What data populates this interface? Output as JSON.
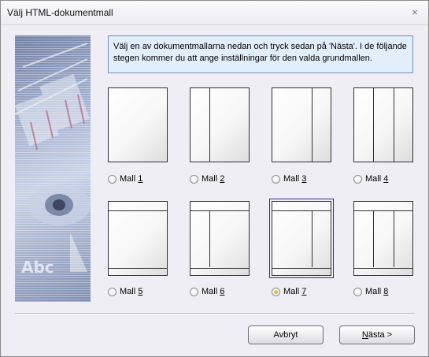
{
  "window": {
    "title": "Välj HTML-dokumentmall",
    "close_glyph": "×"
  },
  "side_art": {
    "text": "Abc"
  },
  "info": {
    "text": "Välj en av dokumentmallarna nedan och tryck sedan på 'Nästa'. I de följande stegen kommer du att ange inställningar för den valda grundmallen."
  },
  "templates": [
    {
      "label": "Mall ",
      "num": "1",
      "selected": false
    },
    {
      "label": "Mall ",
      "num": "2",
      "selected": false
    },
    {
      "label": "Mall ",
      "num": "3",
      "selected": false
    },
    {
      "label": "Mall ",
      "num": "4",
      "selected": false
    },
    {
      "label": "Mall ",
      "num": "5",
      "selected": false
    },
    {
      "label": "Mall ",
      "num": "6",
      "selected": false
    },
    {
      "label": "Mall ",
      "num": "7",
      "selected": true
    },
    {
      "label": "Mall ",
      "num": "8",
      "selected": false
    }
  ],
  "buttons": {
    "cancel": "Avbryt",
    "next_hotkey": "N",
    "next_rest": "ästa >"
  },
  "colors": {
    "info_bg": "#e3eefb",
    "info_border": "#6f8fbf",
    "selected_outline": "#2d2e8c",
    "radio_selected": "#d98a1a"
  }
}
